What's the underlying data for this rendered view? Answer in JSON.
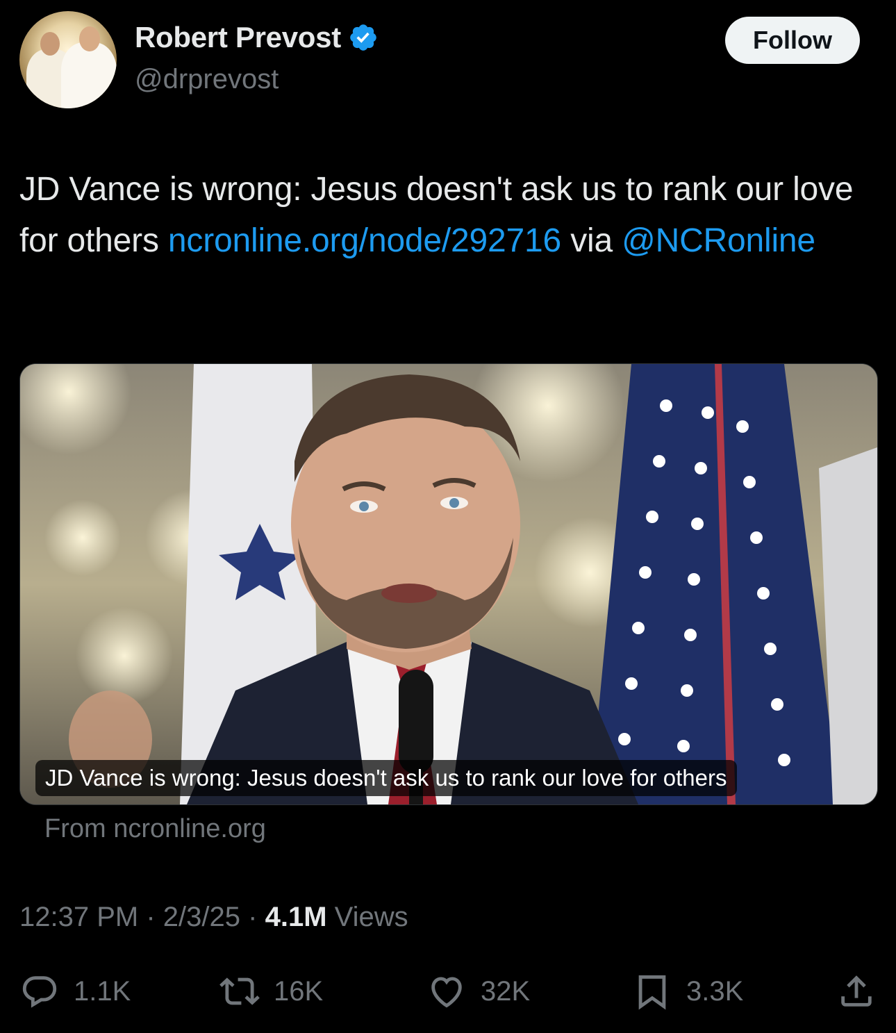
{
  "author": {
    "name": "Robert Prevost",
    "handle": "@drprevost",
    "verified": true
  },
  "follow_label": "Follow",
  "tweet": {
    "text_prefix": "JD Vance is wrong: Jesus doesn't ask us to rank our love for others",
    "link": "ncronline.org/node/292716",
    "via": "via",
    "mention": "@NCRonline"
  },
  "card": {
    "caption": "JD Vance is wrong: Jesus doesn't ask us to rank our love for others",
    "source": "From ncronline.org"
  },
  "meta": {
    "time": "12:37 PM",
    "sep1": "·",
    "date": "2/3/25",
    "sep2": "·",
    "views_count": "4.1M",
    "views_label": "Views"
  },
  "actions": {
    "replies": "1.1K",
    "reposts": "16K",
    "likes": "32K",
    "bookmarks": "3.3K"
  },
  "colors": {
    "background": "#000000",
    "text": "#e7e9ea",
    "secondary": "#71767b",
    "link": "#1d9bf0",
    "verified": "#1d9bf0"
  },
  "icons": [
    "verified-badge-icon",
    "reply-icon",
    "repost-icon",
    "like-icon",
    "bookmark-icon",
    "share-icon"
  ]
}
